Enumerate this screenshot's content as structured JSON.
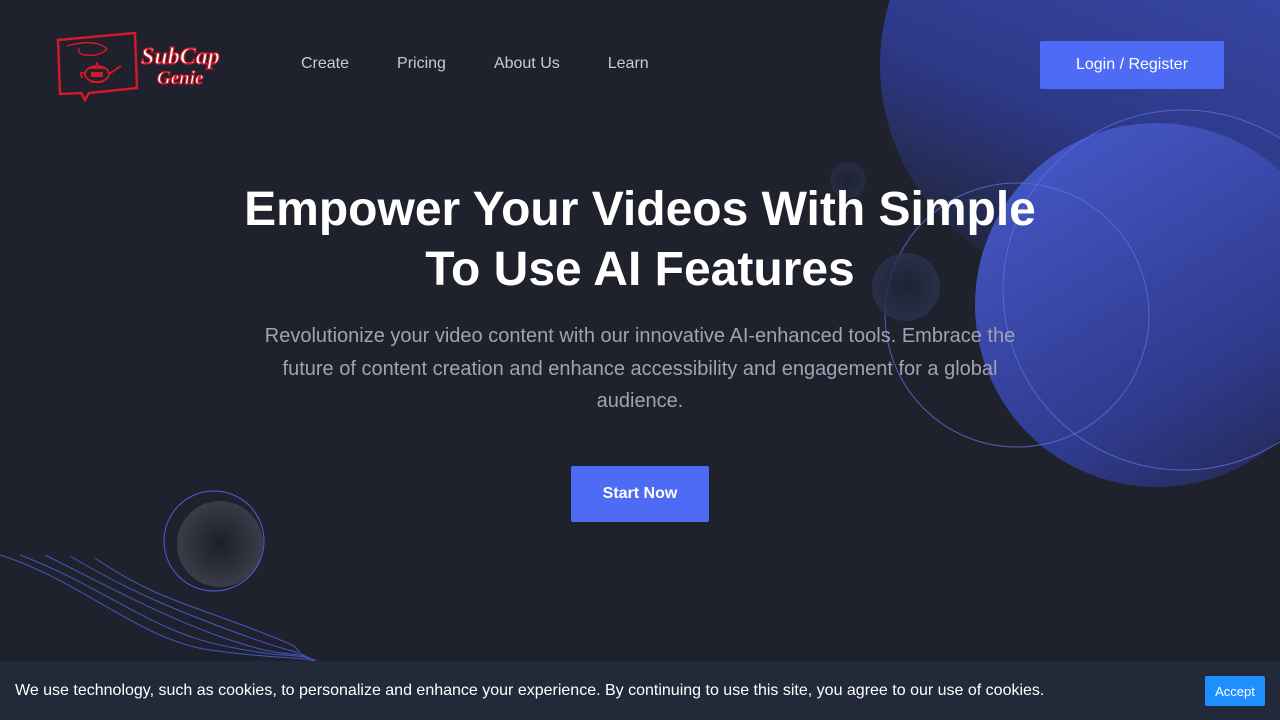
{
  "header": {
    "logo_alt": "SubCap Genie",
    "logo_line1": "SubCap",
    "logo_line2": "Genie",
    "nav": [
      {
        "label": "Create"
      },
      {
        "label": "Pricing"
      },
      {
        "label": "About Us"
      },
      {
        "label": "Learn"
      }
    ],
    "login_label": "Login / Register"
  },
  "hero": {
    "title": "Empower Your Videos With Simple To Use AI Features",
    "subtitle": "Revolutionize your video content with our innovative AI-enhanced tools. Embrace the future of content creation and enhance accessibility and engagement for a global audience.",
    "cta_label": "Start Now"
  },
  "cookie": {
    "text": "We use technology, such as cookies, to personalize and enhance your experience. By continuing to use this site, you agree to our use of cookies.",
    "accept_label": "Accept"
  },
  "colors": {
    "background": "#1f222d",
    "accent": "#4d6bf5",
    "logo_red": "#d6182a",
    "cookie_bg": "#222a39",
    "accept": "#1f8fff"
  }
}
